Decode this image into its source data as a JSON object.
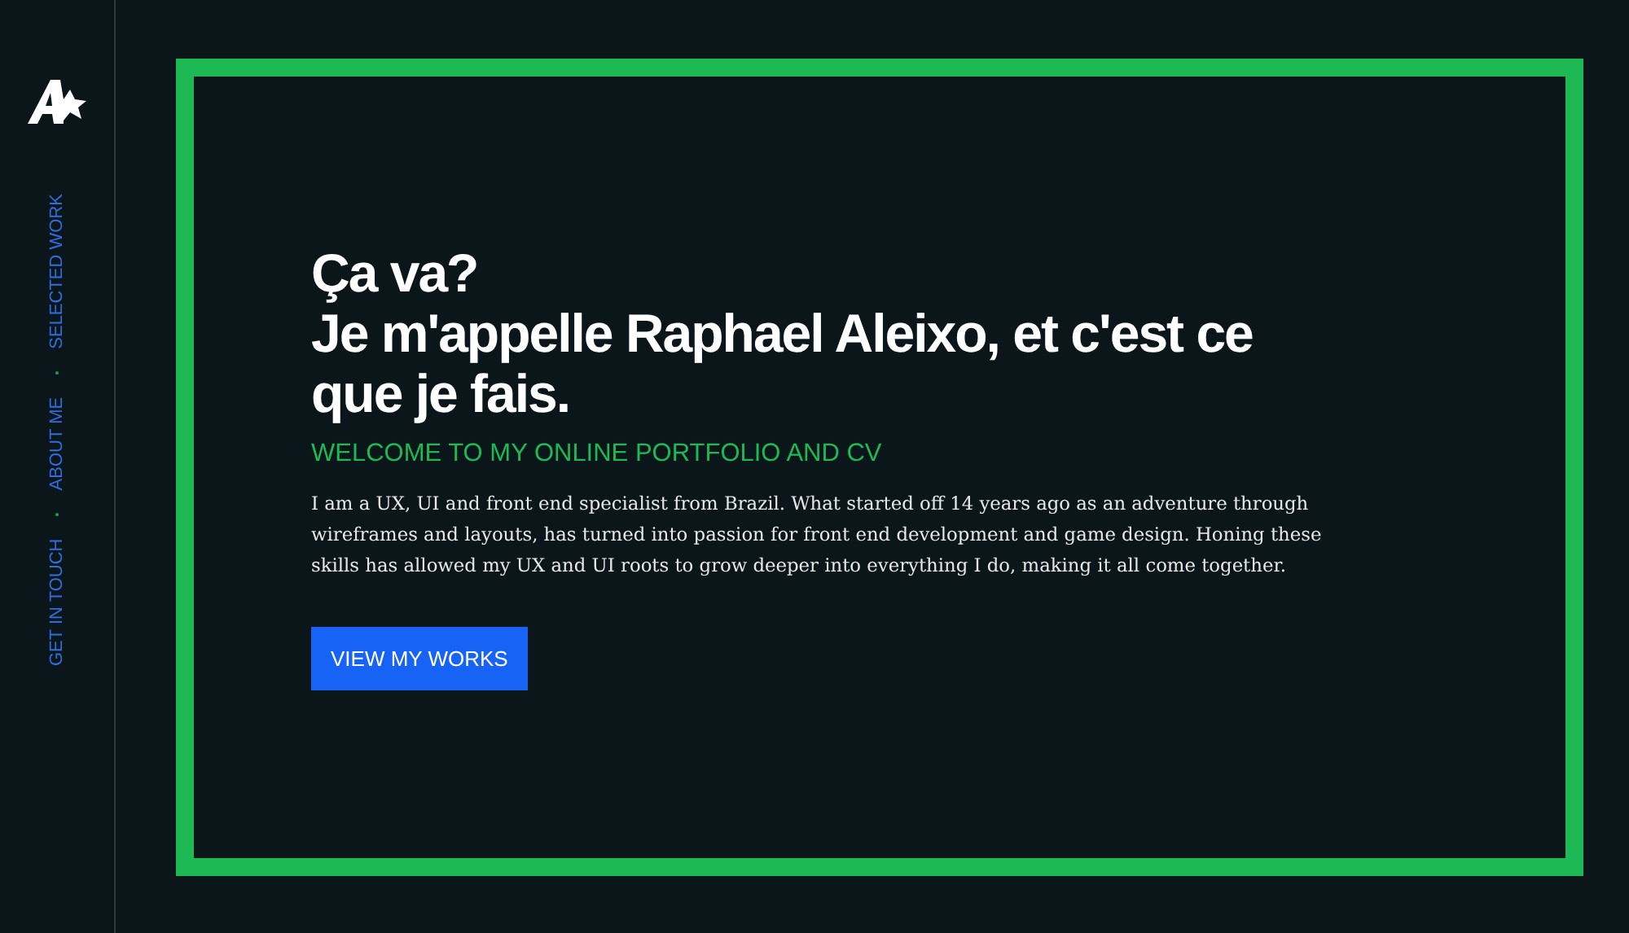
{
  "nav": [
    {
      "label": "SELECTED WORK"
    },
    {
      "label": "ABOUT ME"
    },
    {
      "label": "GET IN TOUCH"
    }
  ],
  "hero": {
    "greeting": "Ça va?",
    "title": "Je m'appelle Raphael Aleixo, et c'est ce que je fais.",
    "subtitle": "WELCOME TO MY ONLINE PORTFOLIO AND CV",
    "intro": "I am a UX, UI and front end specialist from Brazil. What started off 14 years ago as an adventure through wireframes and layouts, has turned into passion for front end development and game design. Honing these skills has allowed my UX and UI roots to grow deeper into everything I do, making it all come together.",
    "button": "VIEW MY WORKS"
  }
}
